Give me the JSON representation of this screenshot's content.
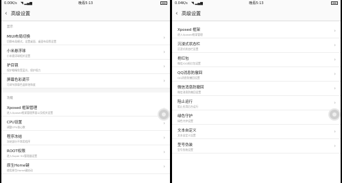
{
  "left": {
    "status": {
      "speed": "0.00K/s",
      "signal": "◥ ▂▄▆",
      "clock": "晚看5:13"
    },
    "title": "高级设置",
    "section1_header": "显示",
    "items1": [
      {
        "label": "MIUI布局切换",
        "desc": "切换布局模式，设置桌面、桌面布局等设置"
      },
      {
        "label": "小米悬浮球",
        "desc": "小米悬浮球相关设置"
      },
      {
        "label": "护目镜",
        "desc": "保护眼睛免受蓝光、保护视力"
      },
      {
        "label": "屏幕色彩调节",
        "desc": "可调节屏幕色温和饱和度"
      }
    ],
    "section2_header": "功能",
    "items2": [
      {
        "label": "Xposed 框架管理",
        "desc": "进入Xposed框架管理界面以及相关设置"
      },
      {
        "label": "CPU设置",
        "desc": "调整CPU核心数"
      },
      {
        "label": "程序冻结",
        "desc": "冻结部分不常用程序"
      },
      {
        "label": "ROOT权限",
        "desc": "进入Super SU管理器设置"
      },
      {
        "label": "原生Home键",
        "desc": "使用原生Home键启动"
      }
    ]
  },
  "right": {
    "status": {
      "speed": "0.04K/s",
      "signal": "◥ ▂▄▆",
      "clock": "晚看5:13"
    },
    "title": "高级设置",
    "items": [
      {
        "label": "Xposed 框架",
        "desc": "进入Xposed框架管理"
      },
      {
        "label": "沉浸式状态栏",
        "desc": "沉浸式状态栏设置"
      },
      {
        "label": "抢红包",
        "desc": "微信/QQ抢红包设置"
      },
      {
        "label": "QQ消息防撤回",
        "desc": "QQ消息防撤回设置"
      },
      {
        "label": "微信消息防撤回",
        "desc": "微信消息防撤回设置"
      },
      {
        "label": "阻止运行",
        "desc": "阻止应用后台运行"
      },
      {
        "label": "绿色守护",
        "desc": "绿色守护设置"
      },
      {
        "label": "文本自定义",
        "desc": "文本自定义设置"
      },
      {
        "label": "型号伪装",
        "desc": "型号伪装设置"
      }
    ]
  },
  "icons": {
    "back": "back-arrow-icon",
    "chevron": "chevron-right-icon",
    "float": "floating-ball-icon"
  }
}
